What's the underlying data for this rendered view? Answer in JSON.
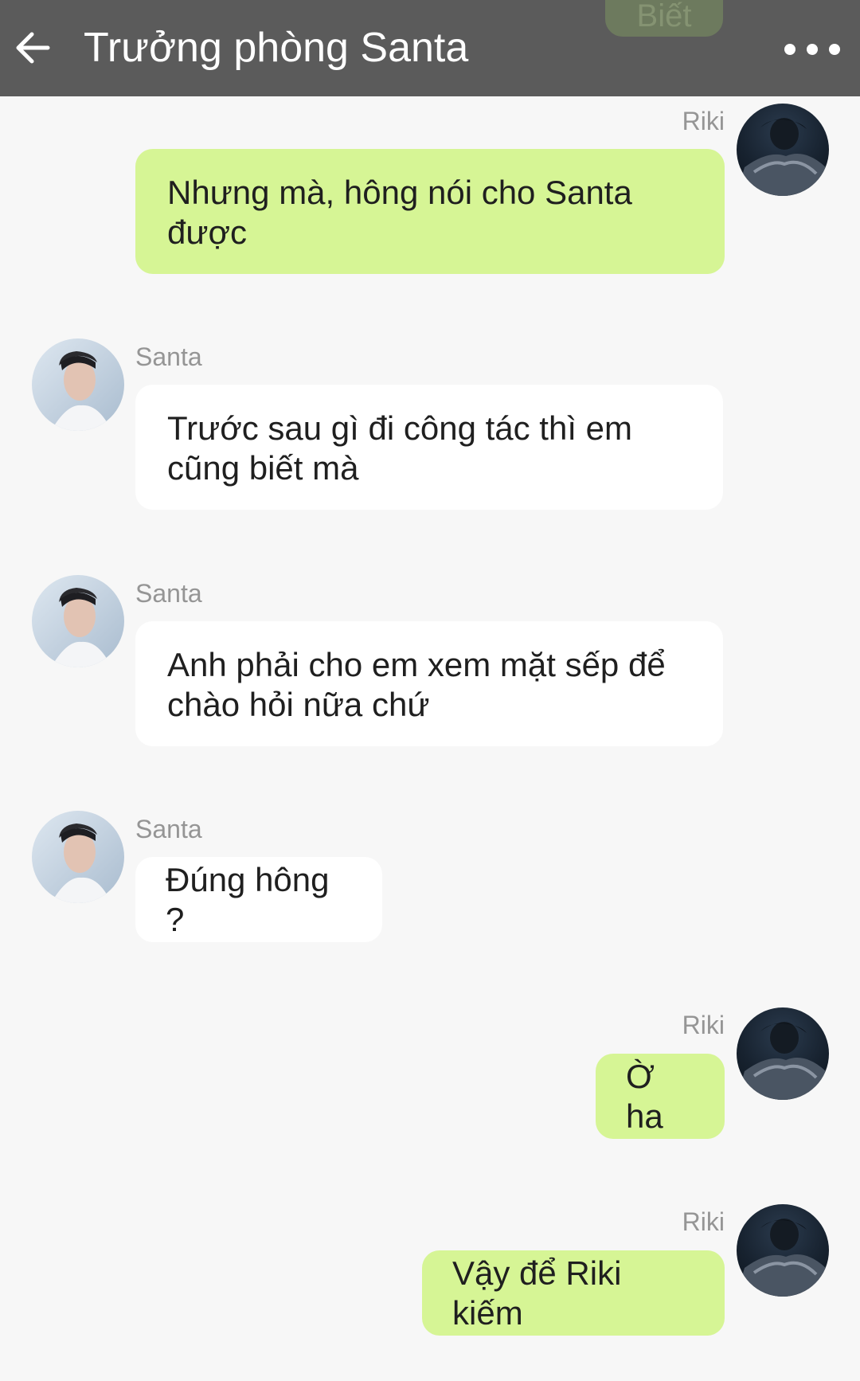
{
  "header": {
    "title": "Trưởng phòng Santa",
    "back_icon": "arrow-left-icon",
    "more_icon": "more-horizontal-icon",
    "partial_bubble_text": "Biết"
  },
  "colors": {
    "header_bg": "#5b5b5b",
    "my_bubble": "#d6f595",
    "their_bubble": "#ffffff",
    "chat_bg": "#f7f7f7",
    "sender_name": "#959595"
  },
  "messages": [
    {
      "sender": "Riki",
      "text": "Nhưng mà, hông nói cho Santa được",
      "side": "right"
    },
    {
      "sender": "Santa",
      "text": "Trước sau gì đi công tác thì em cũng biết mà",
      "side": "left"
    },
    {
      "sender": "Santa",
      "text": "Anh phải cho em xem mặt sếp để chào hỏi nữa chứ",
      "side": "left"
    },
    {
      "sender": "Santa",
      "text": "Đúng hông ?",
      "side": "left"
    },
    {
      "sender": "Riki",
      "text": "Ờ ha",
      "side": "right"
    },
    {
      "sender": "Riki",
      "text": "Vậy để Riki kiếm",
      "side": "right"
    }
  ]
}
